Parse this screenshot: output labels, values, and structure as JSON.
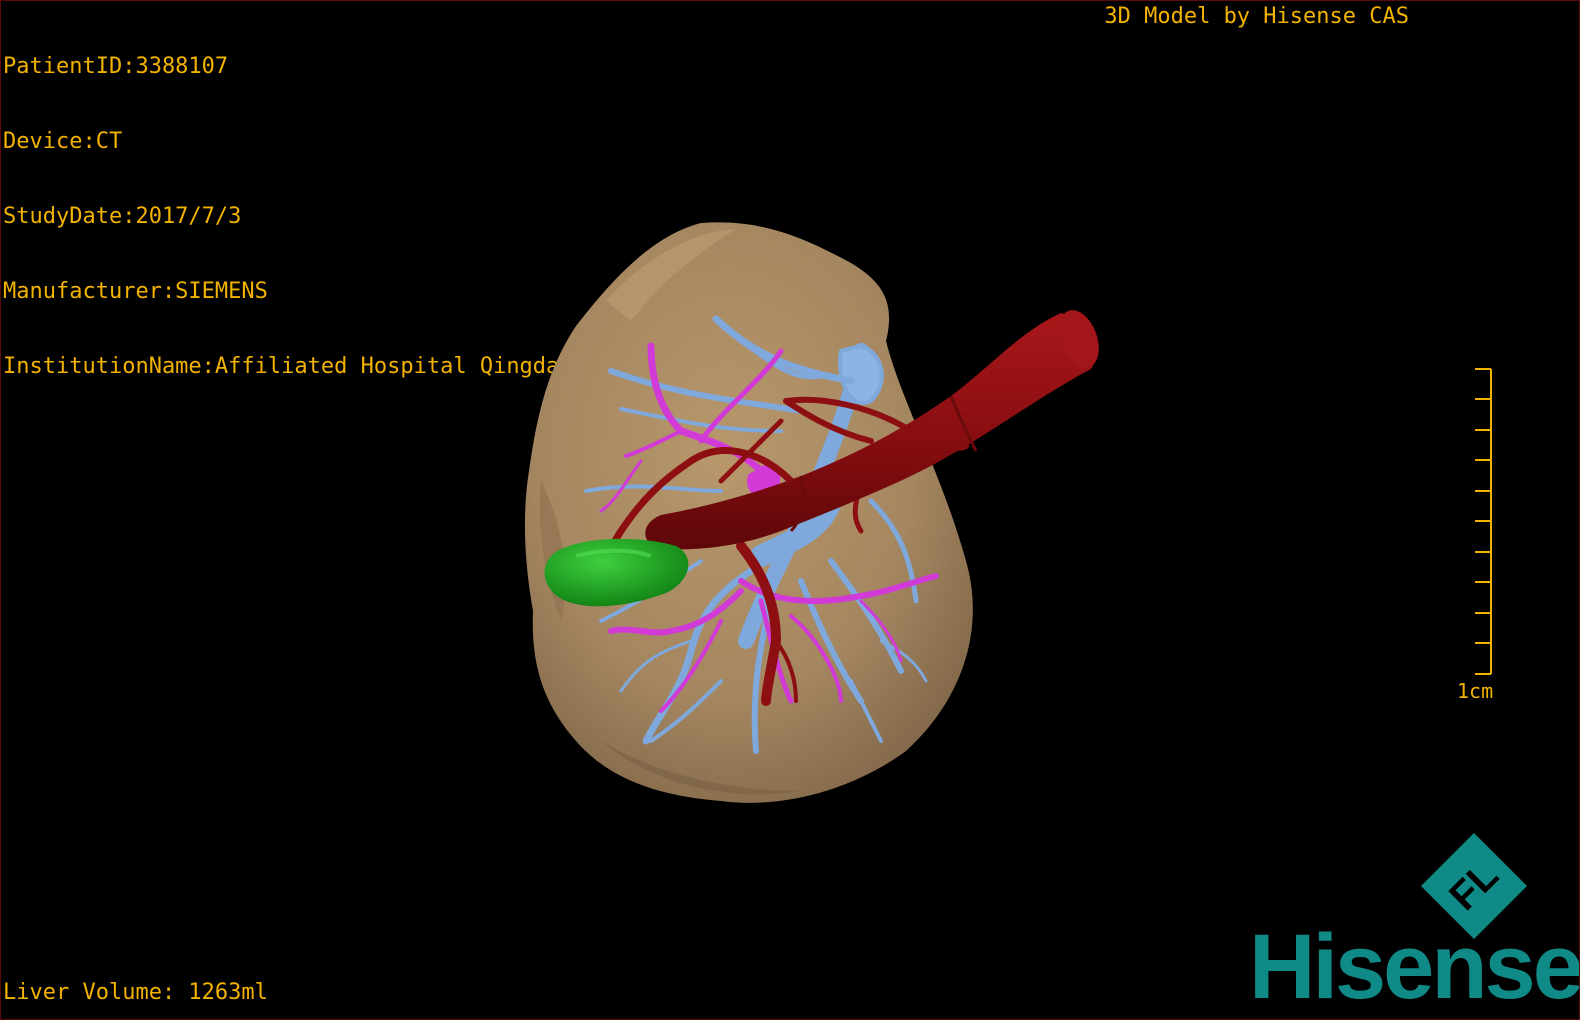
{
  "header": {
    "patient_id": "PatientID:3388107",
    "device": "Device:CT",
    "study_date": "StudyDate:2017/7/3",
    "manufacturer": "Manufacturer:SIEMENS",
    "institution": "InstitutionName:Affiliated Hospital Qingdao University-C"
  },
  "brand_caption": "3D Model by Hisense CAS",
  "footer": {
    "liver_volume": "Liver Volume: 1263ml"
  },
  "scale_bar": {
    "label": "1cm",
    "tick_count": 11
  },
  "logo": {
    "word": "Hisense",
    "mark_letters": "FL"
  },
  "colors": {
    "overlay_text": "#f2b200",
    "liver": "#a88a62",
    "hepatic_vein": "#7fa8dc",
    "portal_vein": "#d23ad8",
    "artery_ivc": "#8e0f12",
    "gallbladder": "#1fa81f",
    "logo_teal": "#0f8a86"
  },
  "model_structures": [
    "liver",
    "hepatic-vein",
    "portal-vein",
    "artery",
    "gallbladder"
  ]
}
